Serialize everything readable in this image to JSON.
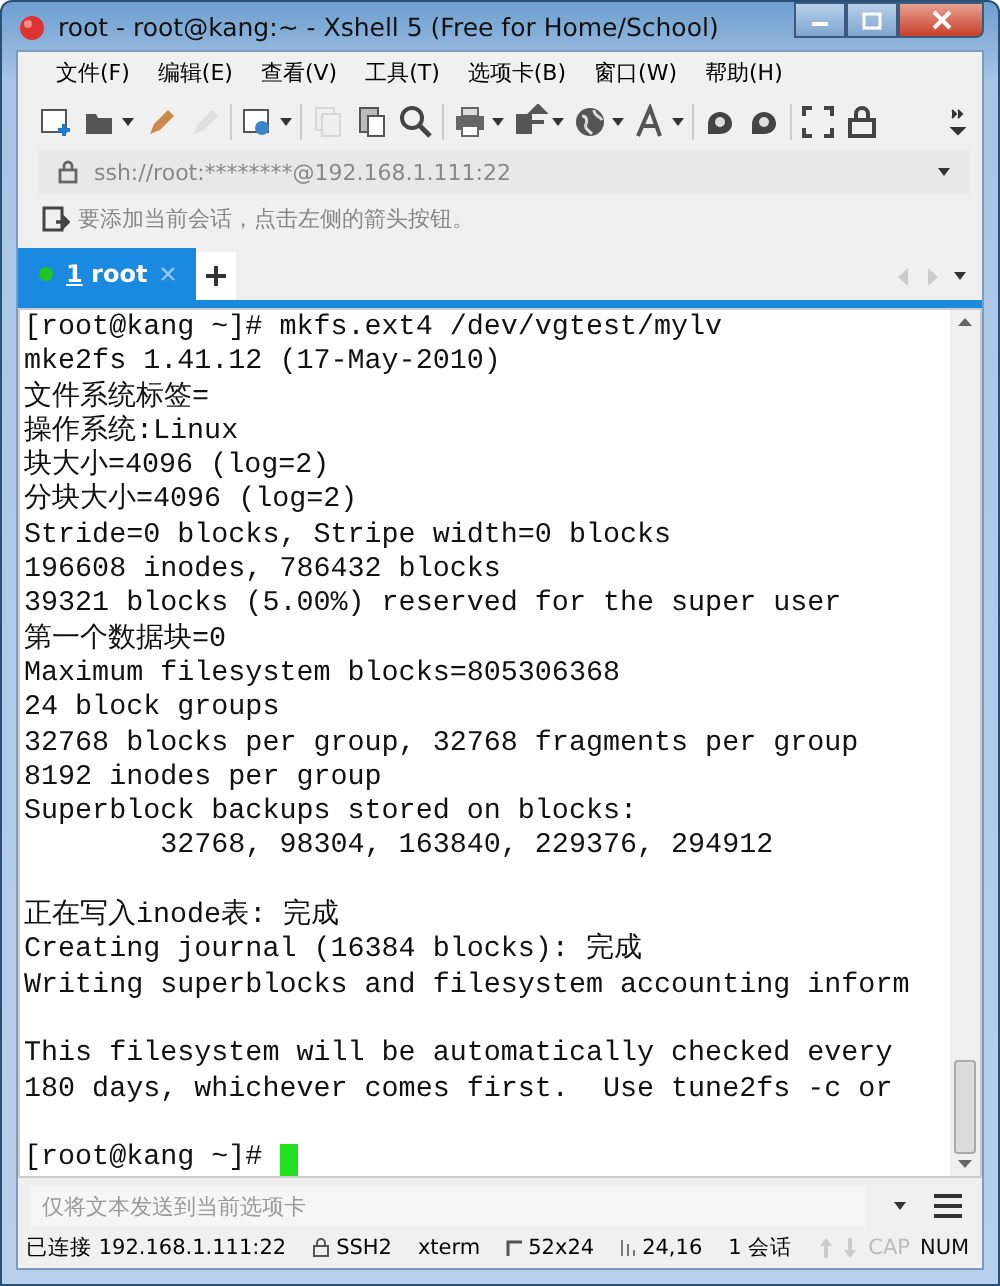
{
  "window": {
    "title": "root - root@kang:~ - Xshell 5 (Free for Home/School)"
  },
  "menu": [
    "文件(F)",
    "编辑(E)",
    "查看(V)",
    "工具(T)",
    "选项卡(B)",
    "窗口(W)",
    "帮助(H)"
  ],
  "toolbar": [
    {
      "kind": "new",
      "disabled": false
    },
    {
      "kind": "open",
      "disabled": false
    },
    {
      "kind": "pencil",
      "disabled": false
    },
    {
      "kind": "pencil",
      "disabled": true
    },
    {
      "kind": "properties",
      "disabled": false
    },
    {
      "kind": "copy",
      "disabled": true
    },
    {
      "kind": "paste",
      "disabled": false
    },
    {
      "kind": "search",
      "disabled": false
    },
    {
      "kind": "print",
      "disabled": false
    },
    {
      "kind": "transfer",
      "disabled": false
    },
    {
      "kind": "globe",
      "disabled": false
    },
    {
      "kind": "font",
      "disabled": false
    },
    {
      "kind": "shell",
      "disabled": false
    },
    {
      "kind": "shell",
      "disabled": false
    },
    {
      "kind": "fullscreen",
      "disabled": false
    },
    {
      "kind": "lock",
      "disabled": false
    }
  ],
  "address": {
    "value": "ssh://root:********@192.168.1.111:22"
  },
  "hint": "要添加当前会话，点击左侧的箭头按钮。",
  "tabs": [
    {
      "number": "1",
      "label": "root",
      "selected": true,
      "connected": true
    }
  ],
  "terminal": {
    "blocks": [
      [
        "[root@kang ~]# mkfs.ext4 /dev/vgtest/mylv",
        "mke2fs 1.41.12 (17-May-2010)",
        "文件系统标签=",
        "操作系统:Linux",
        "块大小=4096 (log=2)",
        "分块大小=4096 (log=2)",
        "Stride=0 blocks, Stripe width=0 blocks",
        "196608 inodes, 786432 blocks",
        "39321 blocks (5.00%) reserved for the super user",
        "第一个数据块=0",
        "Maximum filesystem blocks=805306368",
        "24 block groups",
        "32768 blocks per group, 32768 fragments per group",
        "8192 inodes per group",
        "Superblock backups stored on blocks:",
        "        32768, 98304, 163840, 229376, 294912"
      ],
      [
        "正在写入inode表: 完成",
        "Creating journal (16384 blocks): 完成",
        "Writing superblocks and filesystem accounting inform"
      ],
      [
        "This filesystem will be automatically checked every",
        "180 days, whichever comes first.  Use tune2fs -c or"
      ]
    ],
    "prompt": "[root@kang ~]#"
  },
  "send_bar": {
    "placeholder": "仅将文本发送到当前选项卡"
  },
  "status": {
    "connection": "已连接 192.168.1.111:22",
    "protocol": "SSH2",
    "terminal_type": "xterm",
    "size": "52x24",
    "cursor": "24,16",
    "sessions": "1 会话",
    "keys": [
      {
        "label": "CAP",
        "on": false
      },
      {
        "label": "NUM",
        "on": true
      }
    ]
  }
}
